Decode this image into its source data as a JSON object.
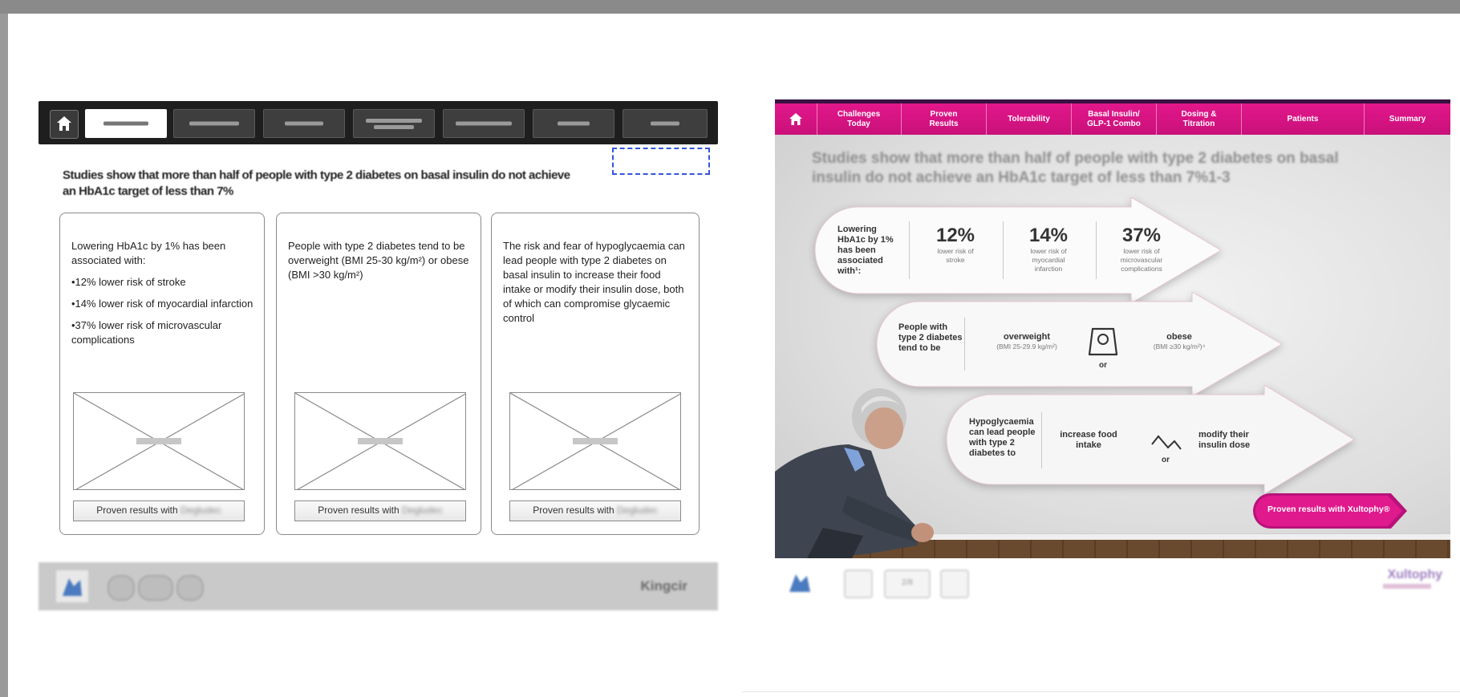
{
  "wireframe": {
    "headline": "Studies show that more than half of people with type 2 diabetes on basal insulin do not achieve an HbA1c target of less than 7%",
    "cards": [
      {
        "paragraphs": [
          "Lowering HbA1c by 1% has been associated with:",
          "•12% lower risk of stroke",
          "•14% lower risk of myocardial infarction",
          "•37% lower risk of microvascular complications"
        ],
        "cta": "Proven results with",
        "cta_brand": "Degludec"
      },
      {
        "paragraphs": [
          "People with type 2 diabetes tend to be overweight (BMI 25-30 kg/m²) or obese (BMI >30 kg/m²)"
        ],
        "cta": "Proven results with",
        "cta_brand": "Degludec"
      },
      {
        "paragraphs": [
          "The risk and fear of hypoglycaemia can lead people with type 2 diabetes on basal insulin to increase their food intake or modify their insulin dose, both of which can compromise glycaemic control"
        ],
        "cta": "Proven results with",
        "cta_brand": "Degludec"
      }
    ],
    "footer_brand": "Kingcir"
  },
  "design": {
    "tabs": [
      "Challenges\nToday",
      "Proven\nResults",
      "Tolerability",
      "Basal Insulin/\nGLP-1 Combo",
      "Dosing &\nTitration",
      "Patients",
      "Summary"
    ],
    "headline": "Studies show that more than half of people with type 2 diabetes on basal insulin do not achieve an HbA1c target of less than 7%1-3",
    "arrow1": {
      "label": "Lowering HbA1c by 1% has been associated with¹:",
      "stats": [
        {
          "value": "12%",
          "caption": "lower risk of stroke"
        },
        {
          "value": "14%",
          "caption": "lower risk of myocardial infarction"
        },
        {
          "value": "37%",
          "caption": "lower risk of microvascular complications"
        }
      ]
    },
    "arrow2": {
      "label": "People with type 2 diabetes tend to be",
      "left_title": "overweight",
      "left_sub": "(BMI 25-29.9 kg/m²)",
      "or": "or",
      "right_title": "obese",
      "right_sub": "(BMI ≥30 kg/m²)⁴"
    },
    "arrow3": {
      "label": "Hypoglycaemia can lead people with type 2 diabetes to",
      "left_title": "increase food intake",
      "or": "or",
      "right_title": "modify their insulin dose"
    },
    "cta": "Proven results with Xultophy®",
    "page_counter": "2/8",
    "footer_brand": "Xultophy"
  },
  "colors": {
    "accent": "#e3168a",
    "nav_dark": "#1e1e1e"
  }
}
